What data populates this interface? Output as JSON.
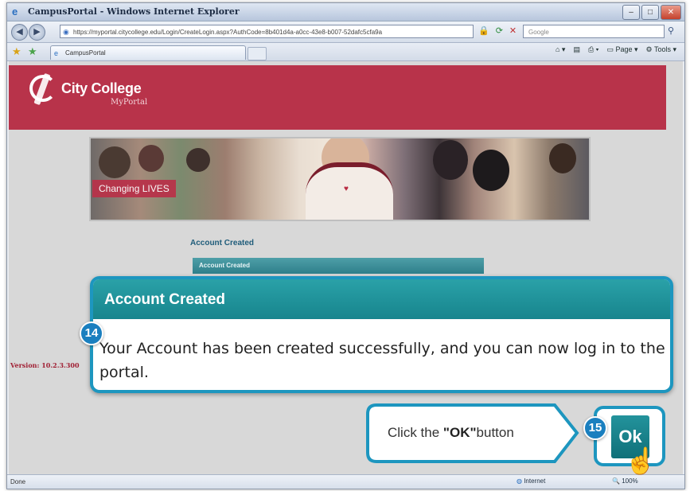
{
  "browser": {
    "window_title": "CampusPortal - Windows Internet Explorer",
    "url": "https://myportal.citycollege.edu/Login/CreateLogin.aspx?AuthCode=8b401d4a-a0cc-43e8-b007-52dafc5cfa9a",
    "search_placeholder": "Google",
    "tab_label": "CampusPortal",
    "page_menu": "Page",
    "tools_menu": "Tools",
    "status_left": "Done",
    "status_zone": "Internet",
    "status_zoom": "100%"
  },
  "site": {
    "logo_title": "City College",
    "logo_subtitle": "MyPortal",
    "banner_tagline": "Changing LIVES",
    "section_heading": "Account Created",
    "section_bar": "Account Created",
    "version": "Version: 10.2.3.300"
  },
  "dialog": {
    "title": "Account Created",
    "message_line1": "Your Account has been created successfully, and you can now log in to the",
    "message_line2": "portal.",
    "step_badge": "14"
  },
  "callout": {
    "text_prefix": "Click the ",
    "text_bold": "\"OK\"",
    "text_suffix": "button",
    "step_badge": "15",
    "ok_label": "Ok"
  },
  "colors": {
    "banner": "#b8334a",
    "dialog_header": "#17858d",
    "callout_border": "#1d96bf",
    "badge": "#1a7fbf"
  }
}
